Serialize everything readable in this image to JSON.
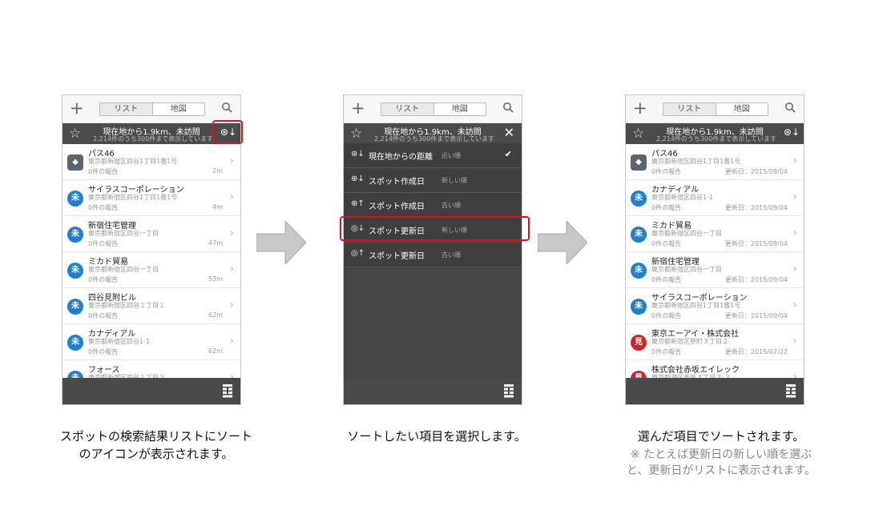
{
  "common": {
    "tab_list": "リスト",
    "tab_map": "地図",
    "header_title": "現在地から1.9km、未訪問",
    "header_sub": "2,214件のうち300件まで表示しています"
  },
  "screen1": {
    "items": [
      {
        "name": "パス46",
        "addr": "東京都新宿区四谷1丁目1番1号",
        "rep": "0件の報告",
        "dist": "2m",
        "pin": "gray",
        "pin_label": "◆"
      },
      {
        "name": "サイラスコーポレーション",
        "addr": "東京都新宿区四谷1丁目1番1号",
        "rep": "0件の報告",
        "dist": "4m",
        "pin": "blue",
        "pin_label": "未"
      },
      {
        "name": "新宿住宅管理",
        "addr": "東京都新宿区四谷一丁目",
        "rep": "0件の報告",
        "dist": "47m",
        "pin": "blue",
        "pin_label": "未"
      },
      {
        "name": "ミカド貿易",
        "addr": "東京都新宿区四谷一丁目",
        "rep": "0件の報告",
        "dist": "53m",
        "pin": "blue",
        "pin_label": "未"
      },
      {
        "name": "四谷見附ビル",
        "addr": "東京都新宿区四谷１丁目１",
        "rep": "0件の報告",
        "dist": "62m",
        "pin": "blue",
        "pin_label": "未"
      },
      {
        "name": "カナディアル",
        "addr": "東京都新宿区四谷1-1",
        "rep": "0件の報告",
        "dist": "62m",
        "pin": "blue",
        "pin_label": "未"
      },
      {
        "name": "フォース",
        "addr": "東京都新宿区四谷１丁目３",
        "rep": "",
        "dist": "",
        "pin": "blue",
        "pin_label": "未"
      }
    ]
  },
  "screen2": {
    "menu": [
      {
        "icon": "distance-icon",
        "label": "現在地からの距離",
        "sub": "近い順",
        "checked": true
      },
      {
        "icon": "created-desc-icon",
        "label": "スポット作成日",
        "sub": "新しい順",
        "checked": false
      },
      {
        "icon": "created-asc-icon",
        "label": "スポット作成日",
        "sub": "古い順",
        "checked": false
      },
      {
        "icon": "updated-desc-icon",
        "label": "スポット更新日",
        "sub": "新しい順",
        "checked": false
      },
      {
        "icon": "updated-asc-icon",
        "label": "スポット更新日",
        "sub": "古い順",
        "checked": false
      }
    ]
  },
  "screen3": {
    "items": [
      {
        "name": "パス46",
        "addr": "東京都新宿区四谷1丁目1番1号",
        "rep": "0件の報告",
        "upd": "更新日：2015/09/04",
        "pin": "gray",
        "pin_label": "◆"
      },
      {
        "name": "カナディアル",
        "addr": "東京都新宿区四谷1-1",
        "rep": "0件の報告",
        "upd": "更新日：2015/09/04",
        "pin": "blue",
        "pin_label": "未"
      },
      {
        "name": "ミカド貿易",
        "addr": "東京都新宿区四谷一丁目",
        "rep": "0件の報告",
        "upd": "更新日：2015/09/04",
        "pin": "blue",
        "pin_label": "未"
      },
      {
        "name": "新宿住宅管理",
        "addr": "東京都新宿区四谷一丁目",
        "rep": "0件の報告",
        "upd": "更新日：2015/09/04",
        "pin": "blue",
        "pin_label": "未"
      },
      {
        "name": "サイラスコーポレーション",
        "addr": "東京都新宿区四谷1丁目1番1号",
        "rep": "0件の報告",
        "upd": "更新日：2015/09/04",
        "pin": "blue",
        "pin_label": "未"
      },
      {
        "name": "東京エーアイ・株式会社",
        "addr": "東京都新宿区原町３丁目２",
        "rep": "0件の報告",
        "upd": "更新日：2015/07/22",
        "pin": "red",
        "pin_label": "見"
      },
      {
        "name": "株式会社赤坂エイレック",
        "addr": "東京都港区赤坂３丁目３-３",
        "rep": "",
        "upd": "",
        "pin": "red",
        "pin_label": "見"
      }
    ]
  },
  "captions": {
    "cap1_line1": "スポットの検索結果リストにソート",
    "cap1_line2": "のアイコンが表示されます。",
    "cap2": "ソートしたい項目を選択します。",
    "cap3": "選んだ項目でソートされます。",
    "note_line1": "※ たとえば更新日の新しい順を選ぶ",
    "note_line2": "と、更新日がリストに表示されます。"
  },
  "colors": {
    "highlight": "#d9141f",
    "header_bg": "#4b4b4b",
    "pin_blue": "#1f7fd0",
    "pin_red": "#d2232a"
  }
}
